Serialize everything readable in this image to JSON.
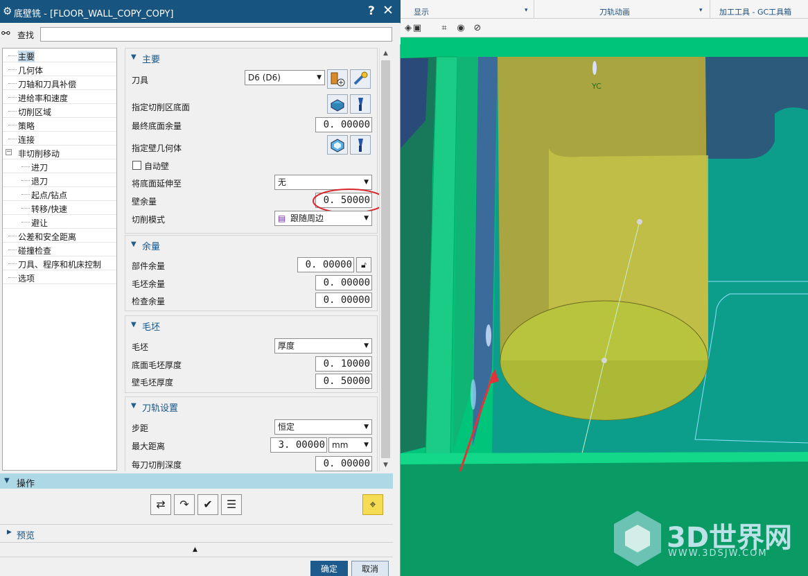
{
  "dialog": {
    "title": "底壁铣 - [FLOOR_WALL_COPY_COPY]",
    "help": "?",
    "close": "✕",
    "find_label": "查找",
    "find_value": ""
  },
  "tree": [
    {
      "label": "主要",
      "level": 0,
      "selected": true
    },
    {
      "label": "几何体",
      "level": 0
    },
    {
      "label": "刀轴和刀具补偿",
      "level": 0
    },
    {
      "label": "进给率和速度",
      "level": 0
    },
    {
      "label": "切削区域",
      "level": 0
    },
    {
      "label": "策略",
      "level": 0
    },
    {
      "label": "连接",
      "level": 0
    },
    {
      "label": "非切削移动",
      "level": 0,
      "expander": "−"
    },
    {
      "label": "进刀",
      "level": 1
    },
    {
      "label": "退刀",
      "level": 1
    },
    {
      "label": "起点/钻点",
      "level": 1
    },
    {
      "label": "转移/快速",
      "level": 1
    },
    {
      "label": "避让",
      "level": 1
    },
    {
      "label": "公差和安全距离",
      "level": 0
    },
    {
      "label": "碰撞检查",
      "level": 0
    },
    {
      "label": "刀具、程序和机床控制",
      "level": 0
    },
    {
      "label": "选项",
      "level": 0
    }
  ],
  "main": {
    "title": "主要",
    "tool_label": "刀具",
    "tool_value": "D6 (D6)",
    "floor_label": "指定切削区底面",
    "final_floor_stock_label": "最终底面余量",
    "final_floor_stock_value": "0. 00000",
    "wall_geom_label": "指定壁几何体",
    "auto_wall_label": "自动壁",
    "extend_floor_label": "将底面延伸至",
    "extend_floor_value": "无",
    "wall_stock_label": "壁余量",
    "wall_stock_value": "0. 50000",
    "cut_pattern_label": "切削模式",
    "cut_pattern_value": "跟随周边"
  },
  "stock": {
    "title": "余量",
    "part_label": "部件余量",
    "part_value": "0. 00000",
    "blank_label": "毛坯余量",
    "blank_value": "0. 00000",
    "check_label": "检查余量",
    "check_value": "0. 00000"
  },
  "blank": {
    "title": "毛坯",
    "blank_label": "毛坯",
    "blank_value": "厚度",
    "floor_thick_label": "底面毛坯厚度",
    "floor_thick_value": "0. 10000",
    "wall_thick_label": "壁毛坯厚度",
    "wall_thick_value": "0. 50000"
  },
  "path": {
    "title": "刀轨设置",
    "stepover_label": "步距",
    "stepover_value": "恒定",
    "max_dist_label": "最大距离",
    "max_dist_value": "3. 00000",
    "max_dist_unit": "mm",
    "depth_label": "每刀切削深度",
    "depth_value": "0. 00000"
  },
  "operations": {
    "title": "操作"
  },
  "preview": {
    "title": "预览"
  },
  "buttons": {
    "ok": "确定",
    "cancel": "取消"
  },
  "app": {
    "display_menu": "显示",
    "toolpath_anim": "刀轨动画",
    "tools_menu": "加工工具 - GC工具箱",
    "axis_label": "YC"
  },
  "watermark": {
    "brand": "3D世界网",
    "url": "WWW.3DSJW.COM"
  }
}
